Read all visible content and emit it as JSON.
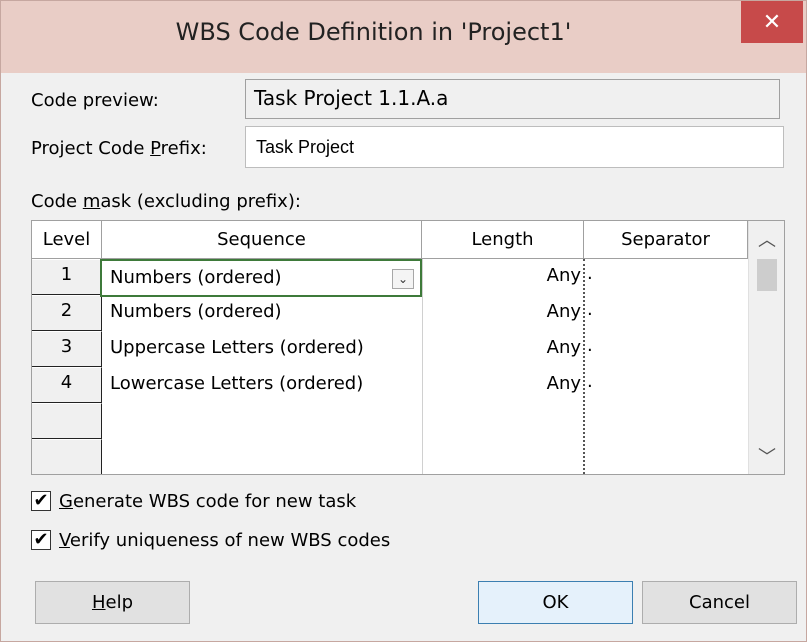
{
  "window": {
    "title": "WBS Code Definition in 'Project1'",
    "close_glyph": "✕"
  },
  "code_preview": {
    "label": "Code preview:",
    "value": "Task Project 1.1.A.a"
  },
  "project_code_prefix": {
    "label_pre": "Project Code ",
    "label_u": "P",
    "label_post": "refix:",
    "value": "Task Project"
  },
  "code_mask": {
    "label_pre": "Code ",
    "label_u": "m",
    "label_post": "ask (excluding prefix):"
  },
  "grid": {
    "headers": {
      "level": "Level",
      "sequence": "Sequence",
      "length": "Length",
      "separator": "Separator"
    },
    "rows": [
      {
        "level": "1",
        "sequence": "Numbers (ordered)",
        "length": "Any",
        "separator": "."
      },
      {
        "level": "2",
        "sequence": "Numbers (ordered)",
        "length": "Any",
        "separator": "."
      },
      {
        "level": "3",
        "sequence": "Uppercase Letters (ordered)",
        "length": "Any",
        "separator": "."
      },
      {
        "level": "4",
        "sequence": "Lowercase Letters (ordered)",
        "length": "Any",
        "separator": "."
      },
      {
        "level": "",
        "sequence": "",
        "length": "",
        "separator": ""
      },
      {
        "level": "",
        "sequence": "",
        "length": "",
        "separator": ""
      }
    ],
    "active_cell_value": "Numbers (ordered)"
  },
  "options": {
    "generate": {
      "checked": true,
      "label_u": "G",
      "label_post": "enerate WBS code for new task"
    },
    "verify": {
      "checked": true,
      "label_u": "V",
      "label_post": "erify uniqueness of new WBS codes"
    }
  },
  "buttons": {
    "help": {
      "label_u": "H",
      "label_post": "elp"
    },
    "ok": {
      "label": "OK"
    },
    "cancel": {
      "label": "Cancel"
    }
  },
  "icons": {
    "check": "✔",
    "chevron_up": "︿",
    "chevron_down": "﹀",
    "dropdown": "⌄"
  }
}
